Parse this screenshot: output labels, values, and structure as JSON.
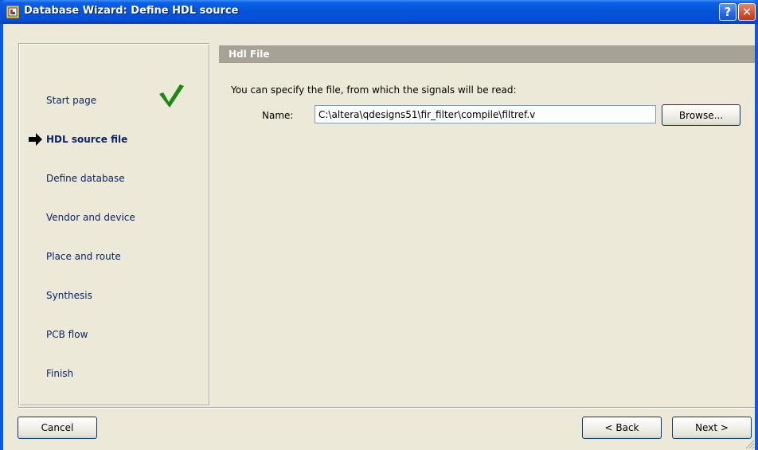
{
  "window": {
    "title": "Database Wizard: Define HDL source",
    "help_label": "?",
    "close_label": "✕"
  },
  "steps": [
    {
      "label": "Start page",
      "state": "completed"
    },
    {
      "label": "HDL source file",
      "state": "current"
    },
    {
      "label": "Define database",
      "state": "pending"
    },
    {
      "label": "Vendor and device",
      "state": "pending"
    },
    {
      "label": "Place and route",
      "state": "pending"
    },
    {
      "label": "Synthesis",
      "state": "pending"
    },
    {
      "label": "PCB flow",
      "state": "pending"
    },
    {
      "label": "Finish",
      "state": "pending"
    }
  ],
  "section": {
    "title": "Hdl File",
    "instruction": "You can specify the file, from which the signals will be read:",
    "name_label": "Name:",
    "name_value": "C:\\altera\\qdesigns51\\fir_filter\\compile\\filtref.v",
    "browse_label": "Browse..."
  },
  "footer": {
    "cancel_label": "Cancel",
    "back_label": "< Back",
    "next_label": "Next >"
  },
  "icons": {
    "completed": "green-checkmark-icon",
    "current": "arrow-right-icon"
  },
  "colors": {
    "titlebar": "#0553d8",
    "client_bg": "#ece9d8",
    "header_bg": "#a6a295",
    "step_text": "#0a246a",
    "check_green": "#1a8a14"
  }
}
